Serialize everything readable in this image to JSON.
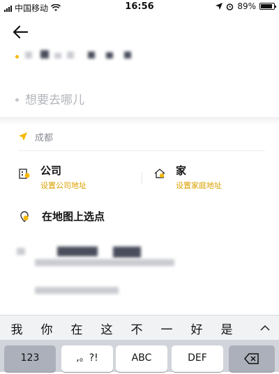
{
  "status_bar": {
    "carrier": "中国移动",
    "time": "16:56",
    "battery": "89%",
    "battery_level": 0.89
  },
  "destination": {
    "placeholder": "想要去哪儿"
  },
  "city": {
    "label": "成都"
  },
  "shortcuts": {
    "company": {
      "title": "公司",
      "subtitle": "设置公司地址"
    },
    "home": {
      "title": "家",
      "subtitle": "设置家庭地址"
    }
  },
  "map_pick": {
    "label": "在地图上选点"
  },
  "keyboard": {
    "candidates": [
      "我",
      "你",
      "在",
      "这",
      "不",
      "一",
      "好",
      "是"
    ],
    "keys": [
      "123",
      ",。?!",
      "ABC",
      "DEF"
    ]
  },
  "colors": {
    "accent": "#f5b800",
    "placeholder": "#b3b5bb"
  }
}
